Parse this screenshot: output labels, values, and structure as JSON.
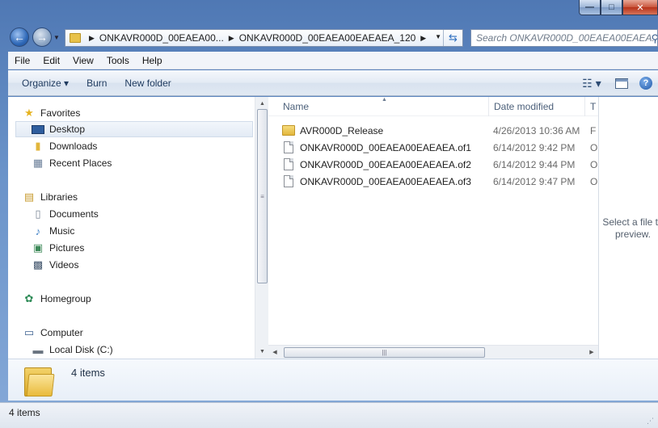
{
  "window": {
    "controls": {
      "minimize": "—",
      "maximize": "□",
      "close": "✕"
    }
  },
  "address": {
    "crumbs": [
      "ONKAVR000D_00EAEA00...",
      "ONKAVR000D_00EAEA00EAEAEA_120"
    ],
    "search_placeholder": "Search ONKAVR000D_00EAEA00EAEA..."
  },
  "menu": {
    "items": [
      "File",
      "Edit",
      "View",
      "Tools",
      "Help"
    ]
  },
  "toolbar": {
    "organize": "Organize ▾",
    "burn": "Burn",
    "new_folder": "New folder"
  },
  "nav": {
    "favorites": "Favorites",
    "desktop": "Desktop",
    "downloads": "Downloads",
    "recent": "Recent Places",
    "libraries": "Libraries",
    "documents": "Documents",
    "music": "Music",
    "pictures": "Pictures",
    "videos": "Videos",
    "homegroup": "Homegroup",
    "computer": "Computer",
    "localdisk": "Local Disk (C:)"
  },
  "columns": {
    "name": "Name",
    "date": "Date modified",
    "type": "T"
  },
  "files": [
    {
      "name": "AVR000D_Release",
      "date": "4/26/2013 10:36 AM",
      "type": "F",
      "kind": "folder"
    },
    {
      "name": "ONKAVR000D_00EAEA00EAEAEA.of1",
      "date": "6/14/2012 9:42 PM",
      "type": "O",
      "kind": "file"
    },
    {
      "name": "ONKAVR000D_00EAEA00EAEAEA.of2",
      "date": "6/14/2012 9:44 PM",
      "type": "O",
      "kind": "file"
    },
    {
      "name": "ONKAVR000D_00EAEA00EAEAEA.of3",
      "date": "6/14/2012 9:47 PM",
      "type": "O",
      "kind": "file"
    }
  ],
  "preview": {
    "message": "Select a file to preview."
  },
  "details": {
    "count": "4 items"
  },
  "status": {
    "count": "4 items"
  }
}
